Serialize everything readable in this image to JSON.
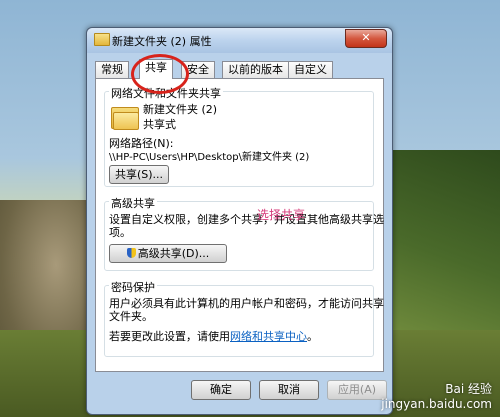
{
  "window": {
    "title": "新建文件夹 (2) 属性",
    "close_label": "✕"
  },
  "tabs": [
    {
      "label": "常规"
    },
    {
      "label": "共享",
      "active": true
    },
    {
      "label": "安全"
    },
    {
      "label": "以前的版本"
    },
    {
      "label": "自定义"
    }
  ],
  "network_sharing": {
    "title": "网络文件和文件夹共享",
    "folder_name": "新建文件夹 (2)",
    "share_status": "共享式",
    "path_label": "网络路径(N):",
    "path_value": "\\\\HP-PC\\Users\\HP\\Desktop\\新建文件夹 (2)",
    "share_button": "共享(S)..."
  },
  "advanced_sharing": {
    "title": "高级共享",
    "description_line1": "设置自定义权限，创建多个共享，并设置其他高级共享选",
    "description_line2": "项。",
    "button": "高级共享(D)..."
  },
  "password": {
    "title": "密码保护",
    "line1": "用户必须具有此计算机的用户帐户和密码，才能访问共享",
    "line2": "文件夹。",
    "line3_prefix": "若要更改此设置，请使用",
    "link": "网络和共享中心",
    "line3_suffix": "。"
  },
  "annotation": "选择共享",
  "footer": {
    "ok": "确定",
    "cancel": "取消",
    "apply": "应用(A)"
  },
  "watermark": "Bai 经验\njingyan.baidu.com"
}
